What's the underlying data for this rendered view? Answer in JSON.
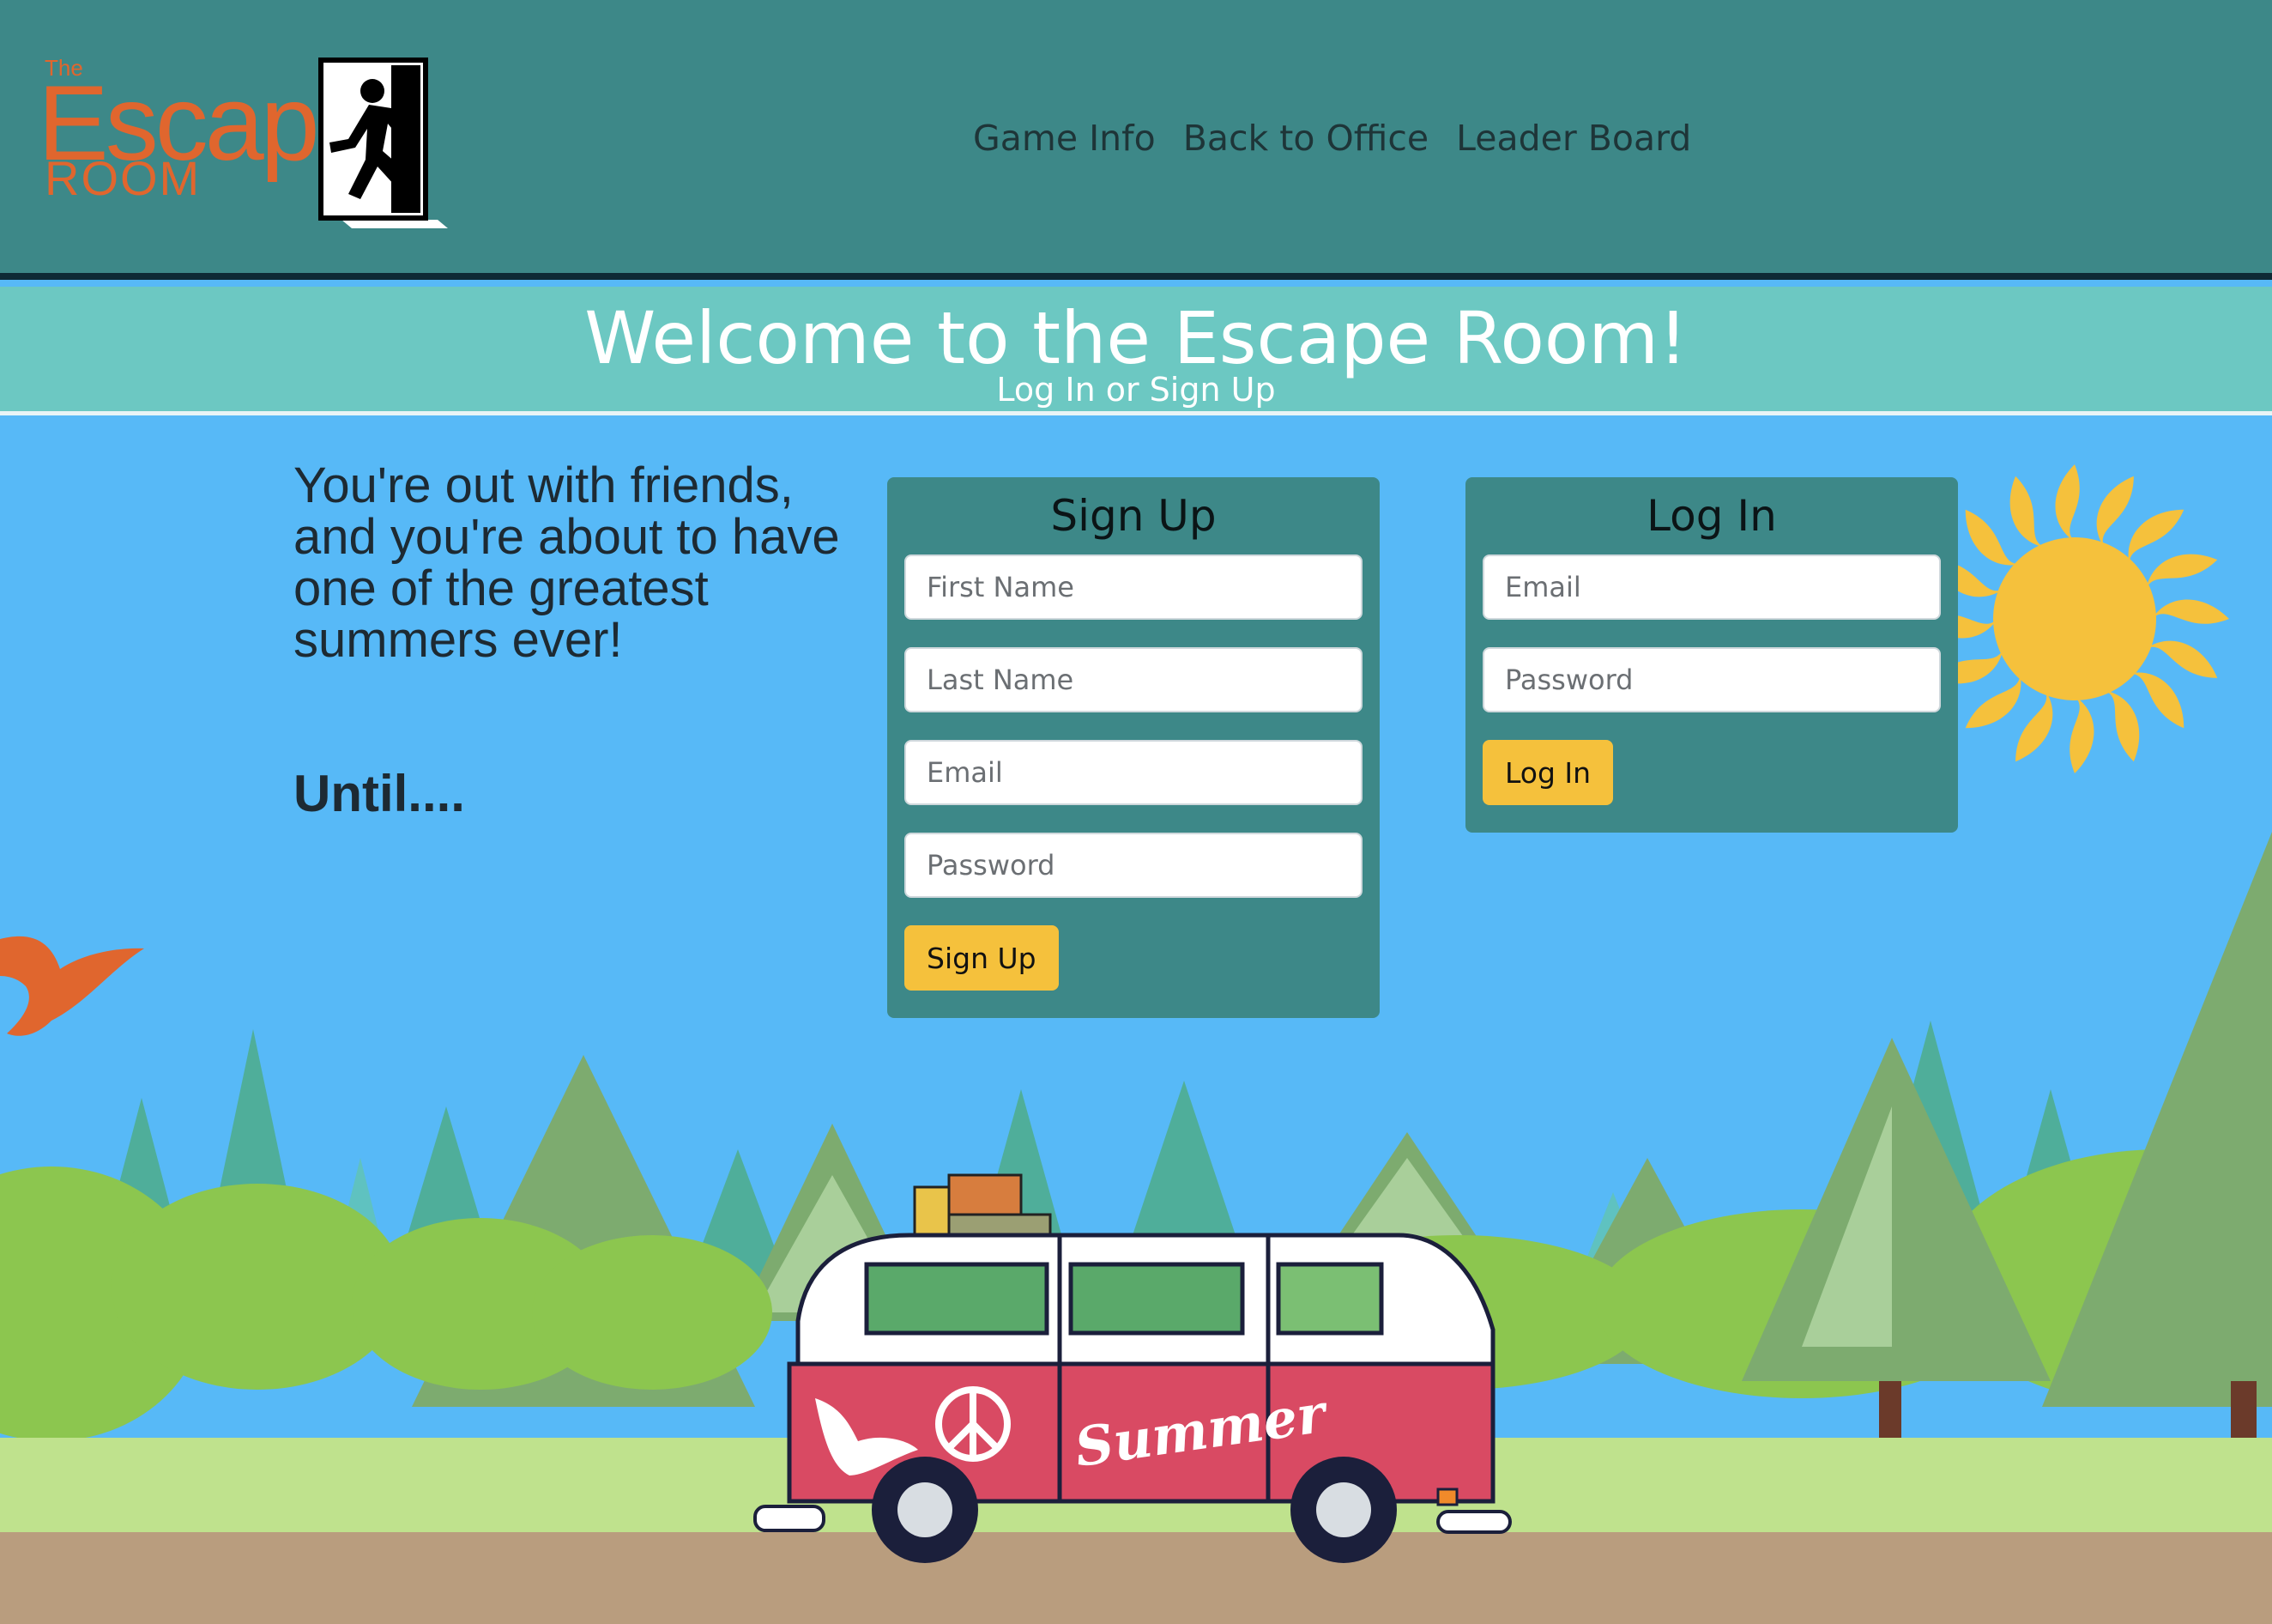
{
  "logo": {
    "small_text": "The",
    "main_text": "Escape",
    "sub_text": "ROOM",
    "icon": "exit-door-running-man-icon"
  },
  "nav": {
    "items": [
      "Game Info",
      "Back to Office",
      "Leader Board"
    ]
  },
  "welcome": {
    "title": "Welcome to the Escape Room!",
    "subtitle": "Log In or Sign Up"
  },
  "intro": {
    "text": "You're out with friends, and you're about to have one of the greatest summers ever!",
    "until": "Until...."
  },
  "signup": {
    "title": "Sign Up",
    "first_name_placeholder": "First Name",
    "last_name_placeholder": "Last Name",
    "email_placeholder": "Email",
    "password_placeholder": "Password",
    "button": "Sign Up"
  },
  "login": {
    "title": "Log In",
    "email_placeholder": "Email",
    "password_placeholder": "Password",
    "button": "Log In"
  },
  "scene": {
    "van_label": "Summer"
  },
  "colors": {
    "header": "#3d8888",
    "welcome_band": "#6cc8c2",
    "sky": "#57b9f7",
    "button": "#f5c13c",
    "logo_orange": "#e0662e"
  }
}
